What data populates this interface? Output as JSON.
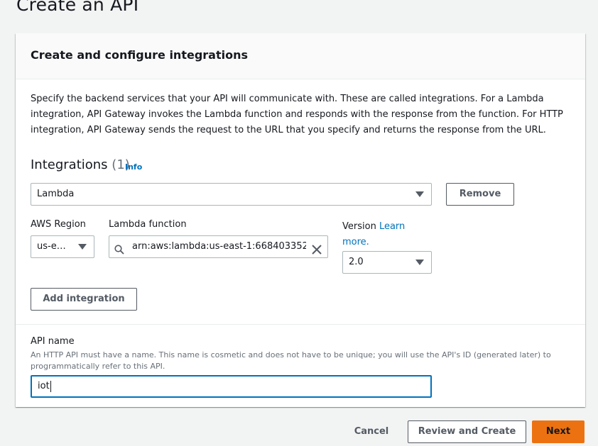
{
  "page": {
    "title": "Create an API"
  },
  "panel": {
    "title": "Create and configure integrations",
    "description": "Specify the backend services that your API will communicate with. These are called integrations. For a Lambda integration, API Gateway invokes the Lambda function and responds with the response from the function. For HTTP integration, API Gateway sends the request to the URL that you specify and returns the response from the URL."
  },
  "integrations": {
    "heading": "Integrations",
    "count": "(1)",
    "info_link": "Info",
    "type_value": "Lambda",
    "remove_label": "Remove",
    "region_label": "AWS Region",
    "region_value": "us-e…",
    "function_label": "Lambda function",
    "function_value": "arn:aws:lambda:us-east-1:668403352’",
    "version_label": "Version",
    "version_link": "Learn more.",
    "version_value": "2.0",
    "add_label": "Add integration"
  },
  "api_name": {
    "label": "API name",
    "hint": "An HTTP API must have a name. This name is cosmetic and does not have to be unique; you will use the API's ID (generated later) to programmatically refer to this API.",
    "value": "iot"
  },
  "footer": {
    "cancel_label": "Cancel",
    "review_label": "Review and Create",
    "next_label": "Next"
  },
  "colors": {
    "accent": "#ec7211",
    "link": "#0073bb",
    "focus": "#0073bb"
  }
}
